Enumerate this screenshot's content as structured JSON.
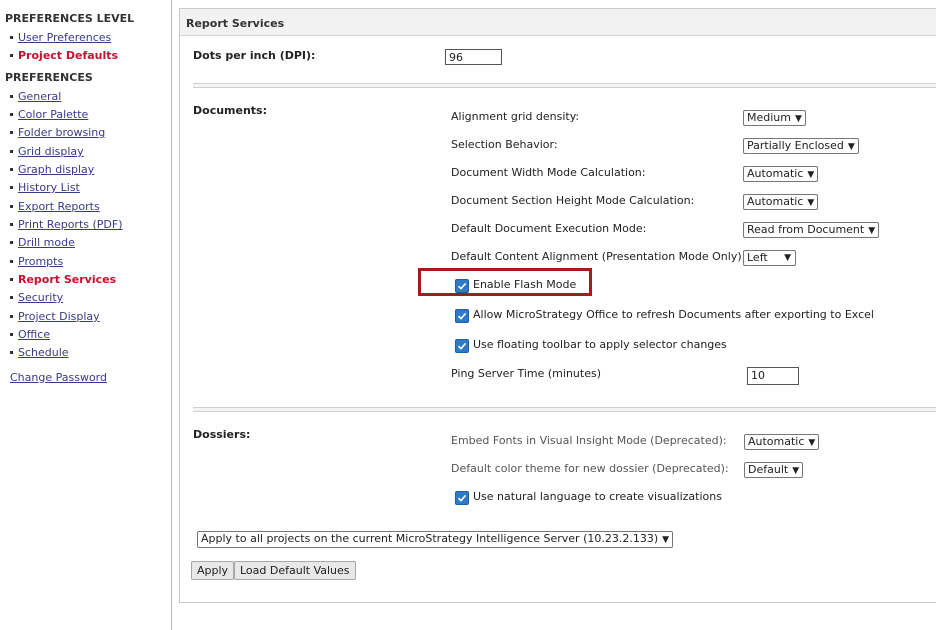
{
  "sidebar": {
    "level_heading": "PREFERENCES LEVEL",
    "level_items": [
      {
        "label": "User Preferences",
        "active": false
      },
      {
        "label": "Project Defaults",
        "active": true
      }
    ],
    "prefs_heading": "PREFERENCES",
    "pref_items": [
      {
        "label": "General"
      },
      {
        "label": "Color Palette"
      },
      {
        "label": "Folder browsing"
      },
      {
        "label": "Grid display"
      },
      {
        "label": "Graph display"
      },
      {
        "label": "History List"
      },
      {
        "label": "Export Reports"
      },
      {
        "label": "Print Reports (PDF)"
      },
      {
        "label": "Drill mode"
      },
      {
        "label": "Prompts"
      },
      {
        "label": "Report Services"
      },
      {
        "label": "Security"
      },
      {
        "label": "Project Display"
      },
      {
        "label": "Office"
      },
      {
        "label": "Schedule"
      }
    ],
    "change_password": "Change Password"
  },
  "panel": {
    "title": "Report Services",
    "dpi_label": "Dots per inch (DPI):",
    "dpi_value": "96",
    "documents": {
      "label": "Documents:",
      "alignment_label": "Alignment grid density:",
      "alignment_value": "Medium",
      "selection_label": "Selection Behavior:",
      "selection_value": "Partially Enclosed",
      "width_mode_label": "Document Width Mode Calculation:",
      "width_mode_value": "Automatic",
      "height_mode_label": "Document Section Height Mode Calculation:",
      "height_mode_value": "Automatic",
      "exec_mode_label": "Default Document Execution Mode:",
      "exec_mode_value": "Read from Document",
      "content_align_label": "Default Content Alignment (Presentation Mode Only):",
      "content_align_value": "Left",
      "flash_mode_label": "Enable Flash Mode",
      "office_refresh_label": "Allow MicroStrategy Office to refresh Documents after exporting to Excel",
      "floating_toolbar_label": "Use floating toolbar to apply selector changes",
      "ping_label": "Ping Server Time (minutes)",
      "ping_value": "10"
    },
    "dossiers": {
      "label": "Dossiers:",
      "embed_fonts_label": "Embed Fonts in Visual Insight Mode (Deprecated):",
      "embed_fonts_value": "Automatic",
      "color_theme_label": "Default color theme for new dossier (Deprecated):",
      "color_theme_value": "Default",
      "natural_language_label": "Use natural language to create visualizations"
    },
    "apply_scope_value": "Apply to all projects on the current MicroStrategy Intelligence Server (10.23.2.133)",
    "apply_button": "Apply",
    "load_defaults_button": "Load Default Values"
  },
  "colors": {
    "active_link": "#c8102e",
    "link": "#3a3a8a",
    "highlight_border": "#a8191c",
    "checkbox": "#2f79c9"
  }
}
